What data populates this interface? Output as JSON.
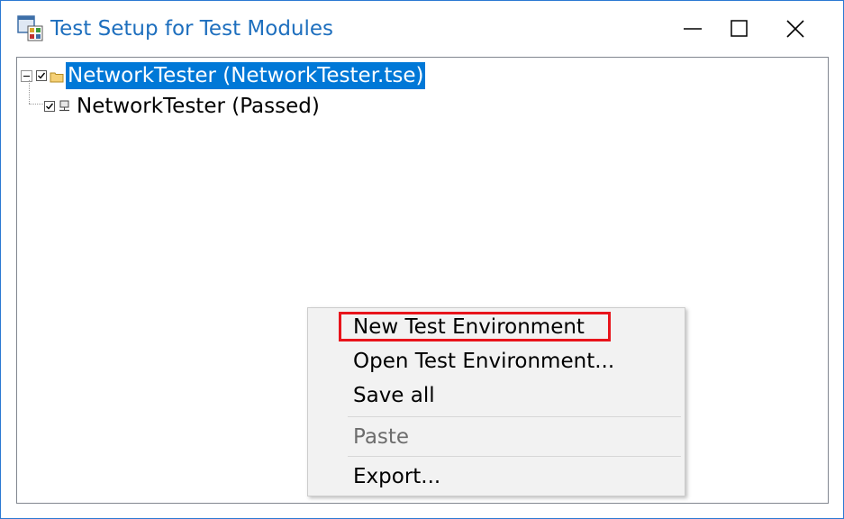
{
  "window": {
    "title": "Test Setup for Test Modules"
  },
  "title_controls": {
    "minimize_icon": "minimize-icon",
    "maximize_icon": "maximize-icon",
    "close_icon": "close-icon"
  },
  "tree": {
    "root": {
      "label": "NetworkTester  (NetworkTester.tse)",
      "expanded": true,
      "checked": true,
      "selected": true,
      "icon": "folder-icon"
    },
    "children": [
      {
        "label": "NetworkTester (Passed)",
        "checked": true,
        "icon": "network-node-icon"
      }
    ]
  },
  "context_menu": {
    "items": [
      {
        "label": "New Test Environment",
        "enabled": true,
        "highlighted": true
      },
      {
        "label": "Open Test Environment...",
        "enabled": true
      },
      {
        "label": "Save all",
        "enabled": true
      },
      {
        "label": "Paste",
        "enabled": false
      },
      {
        "label": "Export...",
        "enabled": true
      }
    ]
  },
  "colors": {
    "accent": "#0078d7",
    "title_text": "#1e6fbe",
    "highlight_box": "#e8141b",
    "menu_bg": "#f2f2f2",
    "disabled_text": "#6d6d6d"
  }
}
